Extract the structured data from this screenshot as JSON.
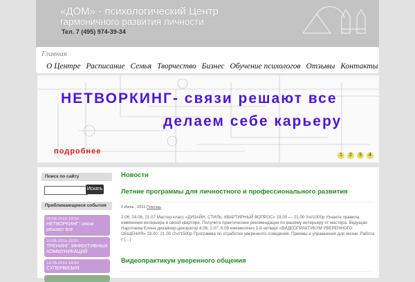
{
  "header": {
    "title_line1": "«ДОМ» - психологический Центр",
    "title_line2": "гармоничного развития личности",
    "phone": "Тел. 7 (495) 974-39-34"
  },
  "nav": {
    "home": "Главная",
    "items": [
      "О Центре",
      "Расписание",
      "Семья",
      "Творчество",
      "Бизнес",
      "Обучение психологов",
      "Отзывы",
      "Контакты"
    ]
  },
  "banner": {
    "line1": "НЕТВОРКИНГ- связи решают все",
    "line2": "делаем себе карьеру",
    "more": "подробнее",
    "pages": [
      "1",
      "2",
      "3",
      "4"
    ]
  },
  "sidebar": {
    "search_title": "Поиск по сайту",
    "search_value": "",
    "search_button": "Искать",
    "events_title": "Приближающиеся события",
    "events": [
      {
        "date": "09.06.2015 19:00",
        "title": "НЕТВОРКИНГ: связи решают все"
      },
      {
        "date": "10.06.2015 19:00",
        "title": "ТРЕНИНГ ЭФФЕКТИВНЫХ КОММУНИКАЦИЙ"
      },
      {
        "date": "18.06.2015 19:00",
        "title": "СУПЕРВИЗИЯ"
      }
    ]
  },
  "main": {
    "section_title": "Новости",
    "posts": [
      {
        "title": "Летние программы для личностного и профессионального развития",
        "date": "2 Июнь , 2015",
        "category": "Помощь",
        "excerpt": "2.06, 24.06, 21.07 Мастер-класс «ДИЗАЙН, СТИЛЬ, КВАРТИРНЫЙ ВОПРОС» 19.00 — 21.00 2ч//1000р  Узнаете правила изменения интерьера в своей квартире. Получите практические рекомендации по вашему интерьеру от мастера. Ведущая: Наротнева Елена дизайнер-декоратор 4.06, 2.07, 6.08 ежемесячно 1-й четверг «ВИДЕОПРАКТИКУМ УВЕРЕННОГО ОБЩЕНИЯ» 19.00- 21.00 /2ч//1500р  Программа по отработке уверенного поведения. Приемы и упражнения для жизни. Работа с […]"
      },
      {
        "title": "Видеопрактикум уверенного общения"
      }
    ]
  }
}
